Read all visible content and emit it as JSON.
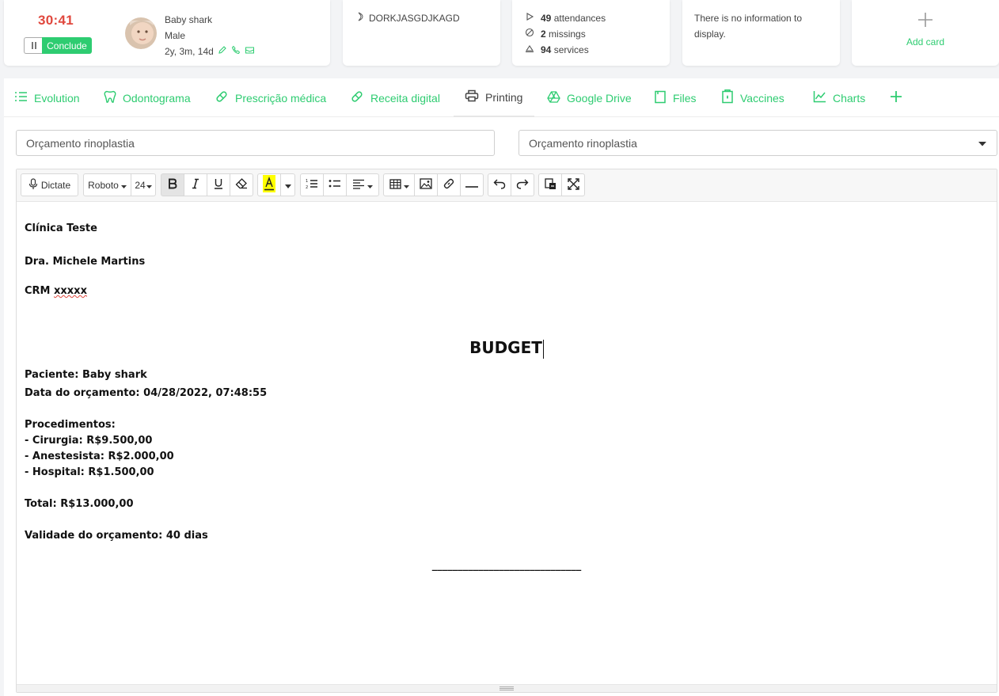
{
  "timer_card": {
    "timer": "30:41",
    "conclude_label": "Conclude",
    "patient_name": "Baby shark",
    "patient_gender": "Male",
    "patient_age": "2y, 3m, 14d"
  },
  "code_card": {
    "code": "DORKJASGDJKAGD"
  },
  "stats_card": {
    "attendances_count": "49",
    "attendances_label": "attendances",
    "missings_count": "2",
    "missings_label": "missings",
    "services_count": "94",
    "services_label": "services"
  },
  "info_card": {
    "text": "There is no information to display."
  },
  "add_card": {
    "label": "Add card"
  },
  "tabs": [
    {
      "label": "Evolution",
      "icon": "list-icon"
    },
    {
      "label": "Odontograma",
      "icon": "tooth-icon"
    },
    {
      "label": "Prescrição médica",
      "icon": "pill-icon"
    },
    {
      "label": "Receita digital",
      "icon": "pill-icon"
    },
    {
      "label": "Printing",
      "icon": "printer-icon",
      "active": true
    },
    {
      "label": "Google Drive",
      "icon": "drive-icon"
    },
    {
      "label": "Files",
      "icon": "file-icon"
    },
    {
      "label": "Vaccines",
      "icon": "vaccine-icon"
    },
    {
      "label": "Charts",
      "icon": "chart-icon"
    }
  ],
  "form": {
    "title_value": "Orçamento rinoplastia",
    "model_selected": "Orçamento rinoplastia"
  },
  "toolbar": {
    "dictate_label": "Dictate",
    "font_family": "Roboto",
    "font_size": "24"
  },
  "document": {
    "clinic": "Clínica Teste",
    "doctor": "Dra. Michele Martins",
    "crm_prefix": "CRM",
    "crm_value": "xxxxx",
    "heading": "BUDGET",
    "patient": "Paciente: Baby shark",
    "date": "Data do orçamento: 04/28/2022, 07:48:55",
    "procedures_title": "Procedimentos:",
    "procedures": [
      "- Cirurgia: R$9.500,00",
      "- Anestesista: R$2.000,00",
      "- Hospital: R$1.500,00"
    ],
    "total": "Total: R$13.000,00",
    "validity": "Validade do orçamento: 40 dias",
    "signature_line": "_____________________________"
  },
  "colors": {
    "accent": "#2ecc71",
    "timer": "#e0483e"
  }
}
